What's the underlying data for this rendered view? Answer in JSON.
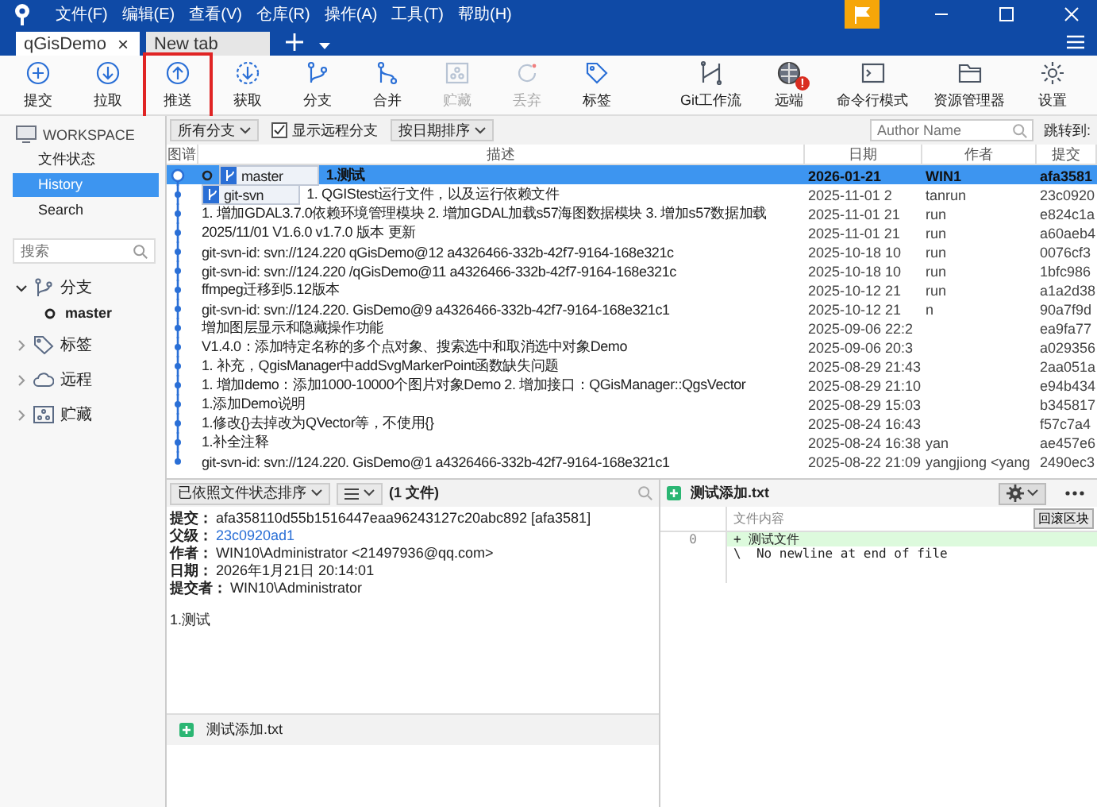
{
  "menu": [
    "文件(F)",
    "编辑(E)",
    "查看(V)",
    "仓库(R)",
    "操作(A)",
    "工具(T)",
    "帮助(H)"
  ],
  "tabs": [
    {
      "label": "qGisDemo",
      "selected": true,
      "close": "×"
    },
    {
      "label": "New tab",
      "selected": false
    }
  ],
  "toolbar": [
    {
      "label": "提交",
      "kind": "commit",
      "disabled": false,
      "highlighted": false
    },
    {
      "label": "拉取",
      "kind": "pull",
      "disabled": false,
      "highlighted": false
    },
    {
      "label": "推送",
      "kind": "push",
      "disabled": false,
      "highlighted": true
    },
    {
      "label": "获取",
      "kind": "fetch",
      "disabled": false,
      "highlighted": false
    },
    {
      "label": "分支",
      "kind": "branch",
      "disabled": false,
      "highlighted": false
    },
    {
      "label": "合并",
      "kind": "merge",
      "disabled": false,
      "highlighted": false
    },
    {
      "label": "贮藏",
      "kind": "stash",
      "disabled": true,
      "highlighted": false
    },
    {
      "label": "丢弃",
      "kind": "discard",
      "disabled": true,
      "highlighted": false
    },
    {
      "label": "标签",
      "kind": "tag",
      "disabled": false,
      "highlighted": false
    }
  ],
  "toolbar_right": [
    {
      "label": "Git工作流",
      "kind": "flow"
    },
    {
      "label": "远端",
      "kind": "remote",
      "badge": "!"
    },
    {
      "label": "命令行模式",
      "kind": "terminal"
    },
    {
      "label": "资源管理器",
      "kind": "folder"
    },
    {
      "label": "设置",
      "kind": "settings"
    }
  ],
  "sidebar": {
    "workspace": "WORKSPACE",
    "items": [
      {
        "label": "文件状态",
        "selected": false
      },
      {
        "label": "History",
        "selected": true
      },
      {
        "label": "Search",
        "selected": false
      }
    ],
    "search": {
      "placeholder": "搜索"
    },
    "tree": [
      {
        "label": "分支",
        "kind": "branch",
        "expanded": true,
        "children": [
          {
            "label": "master",
            "current": true
          }
        ]
      },
      {
        "label": "标签",
        "kind": "tag",
        "expanded": false
      },
      {
        "label": "远程",
        "kind": "remote",
        "expanded": false
      },
      {
        "label": "贮藏",
        "kind": "stash",
        "expanded": false
      }
    ]
  },
  "filters": {
    "branches": "所有分支",
    "show_remote": {
      "label": "显示远程分支",
      "checked": true
    },
    "sort": "按日期排序",
    "author": {
      "placeholder": "Author Name"
    },
    "jump": "跳转到:"
  },
  "table": {
    "columns": [
      "图谱",
      "描述",
      "日期",
      "作者",
      "提交"
    ],
    "rows": [
      {
        "refs": [
          "master"
        ],
        "desc": "1.测试",
        "date": "2026-01-21",
        "author": "WIN1",
        "commit": "afa3581",
        "selected": true,
        "head": true
      },
      {
        "refs": [
          "git-svn"
        ],
        "desc": "1. QGIStest运行文件，以及运行依赖文件",
        "date": "2025-11-01 2",
        "author": "tanrun",
        "commit": "23c0920",
        "selected": false,
        "head": false
      },
      {
        "desc": "1. 增加GDAL3.7.0依赖环境管理模块 2. 增加GDAL加载s57海图数据模块 3. 增加s57数据加载",
        "date": "2025-11-01 21",
        "author": "run",
        "commit": "e824c1a",
        "selected": false,
        "head": false
      },
      {
        "desc": "2025/11/01 V1.6.0 v1.7.0 版本 更新",
        "date": "2025-11-01 21",
        "author": "run",
        "commit": "a60aeb4",
        "selected": false,
        "head": false
      },
      {
        "desc": "git-svn-id: svn://124.220 qGisDemo@12 a4326466-332b-42f7-9164-168e321c",
        "date": "2025-10-18 10",
        "author": "run",
        "commit": "0076cf3",
        "selected": false,
        "head": false
      },
      {
        "desc": "git-svn-id: svn://124.220 /qGisDemo@11 a4326466-332b-42f7-9164-168e321c",
        "date": "2025-10-18 10",
        "author": "run",
        "commit": "1bfc986",
        "selected": false,
        "head": false
      },
      {
        "desc": "ffmpeg迁移到5.12版本",
        "date": "2025-10-12 21",
        "author": "run",
        "commit": "a1a2d38",
        "selected": false,
        "head": false
      },
      {
        "desc": "git-svn-id: svn://124.220. GisDemo@9 a4326466-332b-42f7-9164-168e321c1",
        "date": "2025-10-12 21",
        "author": "n",
        "commit": "90a7f9d",
        "selected": false,
        "head": false
      },
      {
        "desc": "增加图层显示和隐藏操作功能",
        "date": "2025-09-06 22:2",
        "commit": "ea9fa77",
        "selected": false,
        "head": false
      },
      {
        "desc": "V1.4.0：添加特定名称的多个点对象、搜索选中和取消选中对象Demo",
        "date": "2025-09-06 20:3",
        "commit": "a029356",
        "selected": false,
        "head": false
      },
      {
        "desc": "1. 补充，QgisManager中addSvgMarkerPoint函数缺失问题",
        "date": "2025-08-29 21:43",
        "commit": "2aa051a",
        "selected": false,
        "head": false
      },
      {
        "desc": "1. 增加demo：添加1000-10000个图片对象Demo 2. 增加接口：QGisManager::QgsVector",
        "date": "2025-08-29 21:10",
        "commit": "e94b434",
        "selected": false,
        "head": false
      },
      {
        "desc": "1.添加Demo说明",
        "date": "2025-08-29 15:03",
        "commit": "b345817",
        "selected": false,
        "head": false
      },
      {
        "desc": "1.修改{}去掉改为QVector等，不使用{}",
        "date": "2025-08-24 16:43",
        "commit": "f57c7a4",
        "selected": false,
        "head": false
      },
      {
        "desc": "1.补全注释",
        "date": "2025-08-24 16:38",
        "author": "yan",
        "commit": "ae457e6",
        "selected": false,
        "head": false
      },
      {
        "desc": "git-svn-id: svn://124.220. GisDemo@1 a4326466-332b-42f7-9164-168e321c1",
        "date": "2025-08-22 21:09",
        "author": "yangjiong <yang",
        "commit": "2490ec3",
        "selected": false,
        "head": false
      }
    ]
  },
  "details": {
    "sort": "已依照文件状态排序",
    "file_count": "(1 文件)",
    "fields": [
      {
        "label": "提交：",
        "value": "afa358110d55b1516447eaa96243127c20abc892 [afa3581]",
        "link": false
      },
      {
        "label": "父级：",
        "value": "23c0920ad1",
        "link": true
      },
      {
        "label": "作者：",
        "value": "WIN10\\Administrator <21497936@qq.com>",
        "link": false
      },
      {
        "label": "日期：",
        "value": "2026年1月21日 20:14:01",
        "link": false
      },
      {
        "label": "提交者：",
        "value": "WIN10\\Administrator",
        "link": false
      }
    ],
    "message": "1.测试",
    "files": [
      "测试添加.txt"
    ]
  },
  "diff": {
    "file": "测试添加.txt",
    "hunk": "文件内容",
    "revert": "回滚区块",
    "lines": [
      {
        "num": "0",
        "text": "+ 测试文件",
        "kind": "added"
      },
      {
        "text": "\\  No newline at end of file",
        "kind": "note"
      }
    ]
  }
}
